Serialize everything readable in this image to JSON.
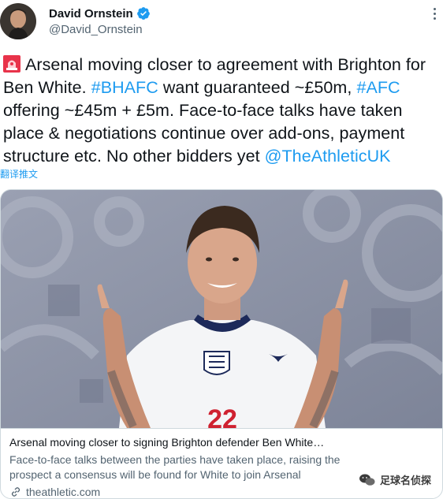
{
  "author": {
    "display_name": "David Ornstein",
    "handle": "@David_Ornstein",
    "verified": true
  },
  "tweet": {
    "segments": [
      {
        "type": "text",
        "value": "Arsenal moving closer to agreement with Brighton for Ben White. "
      },
      {
        "type": "hashtag",
        "value": "#BHAFC"
      },
      {
        "type": "text",
        "value": " want guaranteed ~£50m, "
      },
      {
        "type": "hashtag",
        "value": "#AFC"
      },
      {
        "type": "text",
        "value": " offering ~£45m + £5m. Face-to-face talks have taken place & negotiations continue over add-ons, payment structure etc. No other bidders yet "
      },
      {
        "type": "mention",
        "value": "@TheAthleticUK"
      }
    ],
    "translate_label": "翻译推文"
  },
  "link_card": {
    "title": "Arsenal moving closer to signing Brighton defender Ben White…",
    "description": "Face-to-face talks between the parties have taken place, raising the prospect a consensus will be found for White to join Arsenal",
    "domain": "theathletic.com",
    "shirt_number": "22"
  },
  "watermark": {
    "text": "足球名侦探"
  },
  "colors": {
    "link": "#1d9bf0",
    "verified": "#1d9bf0",
    "secondary_text": "#536471"
  },
  "icons": [
    "avatar",
    "verified-badge-icon",
    "more-options-icon",
    "siren-emoji-icon",
    "link-icon",
    "wechat-icon"
  ]
}
